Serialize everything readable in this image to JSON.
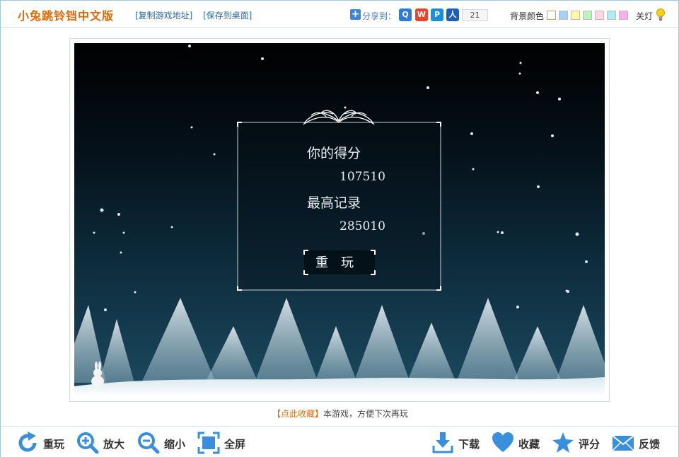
{
  "header": {
    "title": "小兔跳铃铛中文版",
    "copy_link": "[复制游戏地址]",
    "save_link": "[保存到桌面]",
    "share_label": "分享到：",
    "share_count": "21",
    "bg_color_label": "背景颜色",
    "lights_label": "关灯",
    "swatches": [
      "#ffffff",
      "#9fd3f7",
      "#fff7a8",
      "#b8f5b8",
      "#ffd9df",
      "#a8f0f5",
      "#f5b0f0"
    ]
  },
  "game": {
    "score_label": "你的得分",
    "score_value": "107510",
    "best_label": "最高记录",
    "best_value": "285010",
    "replay_label": "重　玩"
  },
  "collect": {
    "link": "【点此收藏】",
    "text": "本游戏，方便下次再玩"
  },
  "toolbar": {
    "replay": "重玩",
    "zoom_in": "放大",
    "zoom_out": "缩小",
    "fullscreen": "全屏",
    "download": "下载",
    "favorite": "收藏",
    "rate": "评分",
    "feedback": "反馈"
  },
  "colors": {
    "brand_orange": "#e06a0a",
    "link_blue": "#2a6aa6",
    "toolbar_icon_blue": "#3a8fdc"
  }
}
